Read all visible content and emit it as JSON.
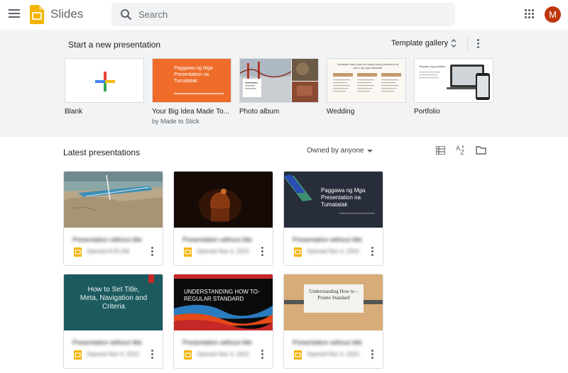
{
  "app": {
    "title": "Slides",
    "avatar_initial": "M",
    "avatar_color": "#bf360c",
    "accent": "#f4b400"
  },
  "search": {
    "placeholder": "Search"
  },
  "templates": {
    "heading": "Start a new presentation",
    "gallery_label": "Template gallery",
    "items": [
      {
        "name": "Blank",
        "icon": "plus-icon"
      },
      {
        "name": "Your Big Idea Made To...",
        "subtitle": "by Made to Stick",
        "thumb_title": "Paggawa ng Mga Presentation na Tumatatak",
        "thumb_color": "#ef6c2a"
      },
      {
        "name": "Photo album"
      },
      {
        "name": "Wedding",
        "thumb_title": "Samahan kami para sa isang buong weekend na puno ng mga aktibidad"
      },
      {
        "name": "Portfolio",
        "thumb_title": "Tingnan ang portfolio"
      }
    ]
  },
  "latest": {
    "heading": "Latest presentations",
    "owner_filter": "Owned by anyone",
    "cards": [
      {
        "title": "Presentation without title",
        "date": "Opened 8:35 AM"
      },
      {
        "title": "Presentation without title",
        "date": "Opened Nov 4, 2022"
      },
      {
        "title": "Presentation without title",
        "date": "Opened Nov 4, 2022",
        "thumb_title": "Paggawa ng Mga Presentation na Tumatatak"
      },
      {
        "title": "Presentation without title",
        "date": "Opened Nov 4, 2022",
        "thumb_title": "How to Set Title, Meta, Navigation and Criteria"
      },
      {
        "title": "Presentation without title",
        "date": "Opened Nov 4, 2022",
        "thumb_title": "UNDERSTANDING HOW TO-REGULAR STANDARD"
      },
      {
        "title": "Presentation without title",
        "date": "Opened Nov 4, 2022",
        "thumb_title": "Understanding How to – Promo Standard"
      }
    ]
  }
}
